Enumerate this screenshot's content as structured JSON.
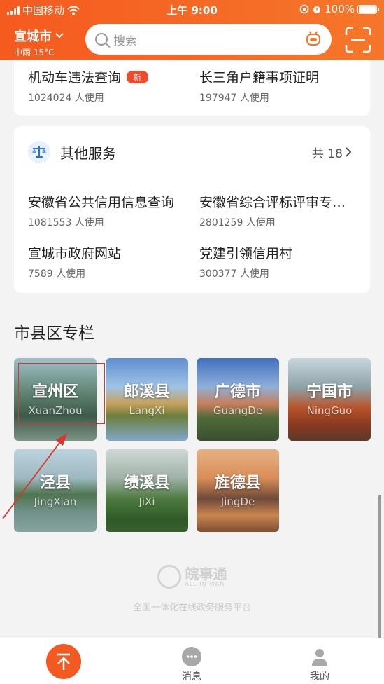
{
  "status_bar": {
    "carrier": "中国移动",
    "time": "上午 9:00",
    "battery": "100%"
  },
  "header": {
    "city": "宣城市",
    "weather": "中雨 15°C",
    "search_placeholder": "搜索",
    "icons": [
      "chevron-down-icon",
      "search-icon",
      "robot-icon",
      "scan-icon"
    ]
  },
  "popular_services": [
    {
      "name": "机动车违法查询",
      "badge": "新",
      "usage": "1024024 人使用"
    },
    {
      "name": "长三角户籍事项证明",
      "usage": "197947 人使用"
    }
  ],
  "other_services": {
    "title": "其他服务",
    "count": "共 18",
    "icon": "scales-icon",
    "items": [
      {
        "name": "安徽省公共信用信息查询",
        "usage": "1081553 人使用"
      },
      {
        "name": "安徽省综合评标评审专…",
        "usage": "2801259 人使用"
      },
      {
        "name": "宣城市政府网站",
        "usage": "7589 人使用"
      },
      {
        "name": "党建引领信用村",
        "usage": "300377 人使用"
      }
    ]
  },
  "districts": {
    "title": "市县区专栏",
    "items": [
      {
        "name": "宣州区",
        "pinyin": "XuanZhou"
      },
      {
        "name": "郎溪县",
        "pinyin": "LangXi"
      },
      {
        "name": "广德市",
        "pinyin": "GuangDe"
      },
      {
        "name": "宁国市",
        "pinyin": "NingGuo"
      },
      {
        "name": "泾县",
        "pinyin": "JingXian"
      },
      {
        "name": "绩溪县",
        "pinyin": "JiXi"
      },
      {
        "name": "旌德县",
        "pinyin": "JingDe"
      }
    ]
  },
  "footer": {
    "brand_name": "皖事通",
    "brand_sub": "ALL IN WAN",
    "slogan": "全国一体化在线政务服务平台"
  },
  "tabbar": {
    "home_icon": "arrow-up-icon",
    "messages": "消息",
    "me": "我的"
  },
  "colors": {
    "accent": "#f55a1f",
    "highlight": "#e0342a"
  }
}
